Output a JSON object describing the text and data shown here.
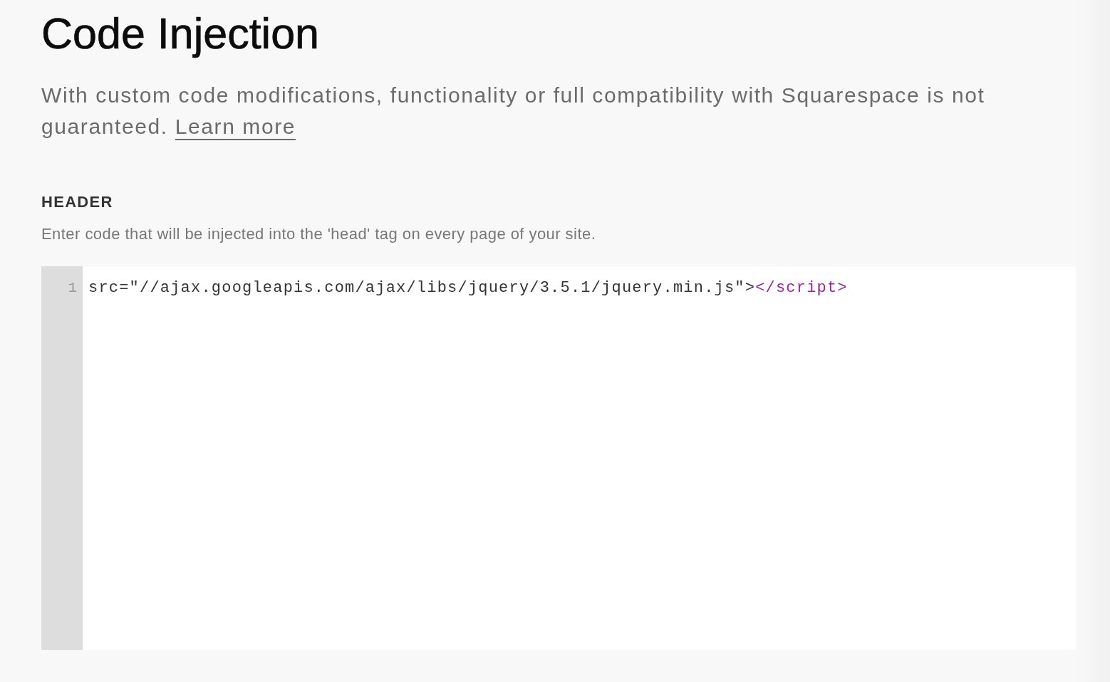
{
  "page": {
    "title": "Code Injection",
    "notice": "With custom code modifications, functionality or full compatibility with Squarespace is not guaranteed.",
    "learn_more_link": "Learn more"
  },
  "sections": [
    {
      "heading": "HEADER",
      "description": "Enter code that will be injected into the 'head' tag on every page of your site.",
      "editor": {
        "lines": [
          {
            "number": "1",
            "tokens": [
              {
                "kind": "text",
                "text": "src=\"//ajax.googleapis.com/ajax/libs/jquery/3.5.1/jquery.min.js\">"
              },
              {
                "kind": "tag",
                "text": "</script>"
              }
            ]
          }
        ]
      }
    }
  ]
}
